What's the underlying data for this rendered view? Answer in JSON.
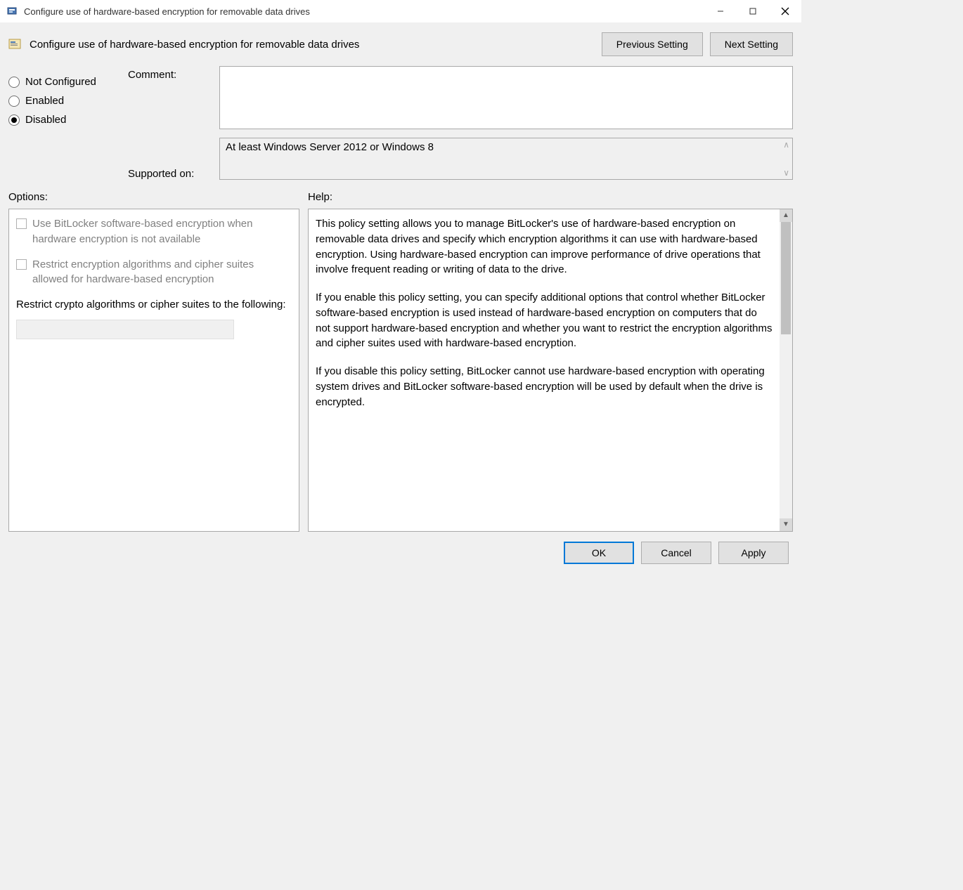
{
  "title": "Configure use of hardware-based encryption for removable data drives",
  "policy_title": "Configure use of hardware-based encryption for removable data drives",
  "nav": {
    "prev": "Previous Setting",
    "next": "Next Setting"
  },
  "state": {
    "not_configured": "Not Configured",
    "enabled": "Enabled",
    "disabled": "Disabled",
    "selected": "disabled"
  },
  "labels": {
    "comment": "Comment:",
    "supported_on": "Supported on:",
    "options": "Options:",
    "help": "Help:"
  },
  "comment_value": "",
  "supported_on_value": "At least Windows Server 2012 or Windows 8",
  "options": {
    "check1": "Use BitLocker software-based encryption when hardware encryption is not available",
    "check2": "Restrict encryption algorithms and cipher suites allowed for hardware-based encryption",
    "restrict_label": "Restrict crypto algorithms or cipher suites to the following:",
    "restrict_value": ""
  },
  "help": {
    "p1": "This policy setting allows you to manage BitLocker's use of hardware-based encryption on removable data drives and specify which encryption algorithms it can use with hardware-based encryption. Using hardware-based encryption can improve performance of drive operations that involve frequent reading or writing of data to the drive.",
    "p2": "If you enable this policy setting, you can specify additional options that control whether BitLocker software-based encryption is used instead of hardware-based encryption on computers that do not support hardware-based encryption and whether you want to restrict the encryption algorithms and cipher suites used with hardware-based encryption.",
    "p3": "If you disable this policy setting, BitLocker cannot use hardware-based encryption with operating system drives and BitLocker software-based encryption will be used by default when the drive is encrypted."
  },
  "footer": {
    "ok": "OK",
    "cancel": "Cancel",
    "apply": "Apply"
  }
}
